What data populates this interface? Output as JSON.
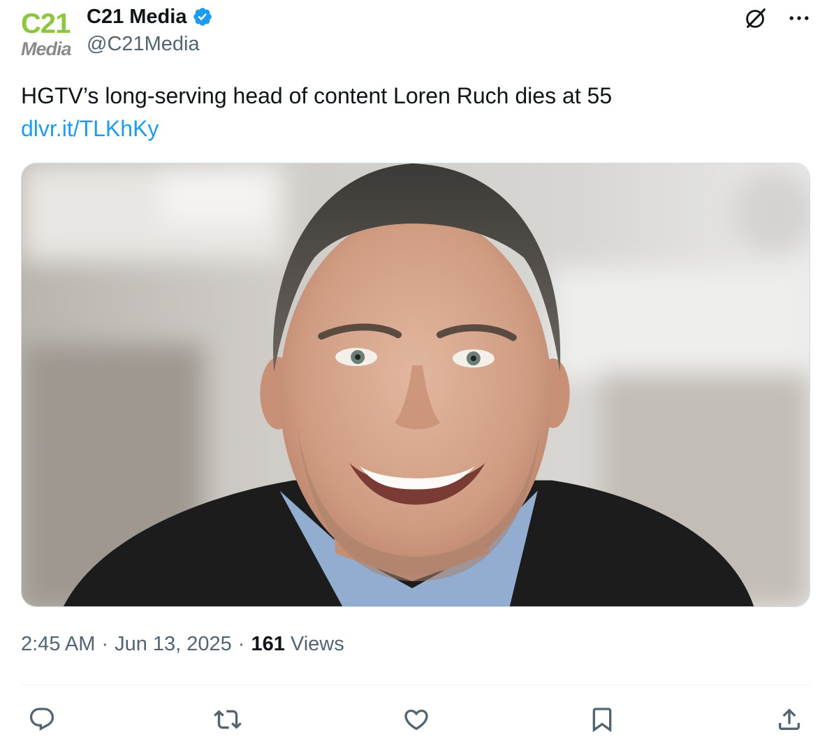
{
  "author": {
    "avatar": {
      "line1": "C21",
      "line2": "Media",
      "brand_color": "#8cc63f"
    },
    "display_name": "C21 Media",
    "verified": true,
    "handle": "@C21Media"
  },
  "header_icons": [
    "grok-icon",
    "more-icon"
  ],
  "tweet": {
    "text": "HGTV’s long-serving head of content Loren Ruch dies at 55",
    "link": "dlvr.it/TLKhKy"
  },
  "media": {
    "subject": "portrait-photo"
  },
  "meta": {
    "time": "2:45 AM",
    "separator": "·",
    "date": "Jun 13, 2025",
    "views_count": "161",
    "views_label": "Views"
  },
  "actions": [
    "reply-icon",
    "retweet-icon",
    "like-icon",
    "bookmark-icon",
    "share-icon"
  ],
  "colors": {
    "text": "#0f1419",
    "secondary": "#536471",
    "link": "#1d9bf0",
    "verified": "#1d9bf0"
  }
}
